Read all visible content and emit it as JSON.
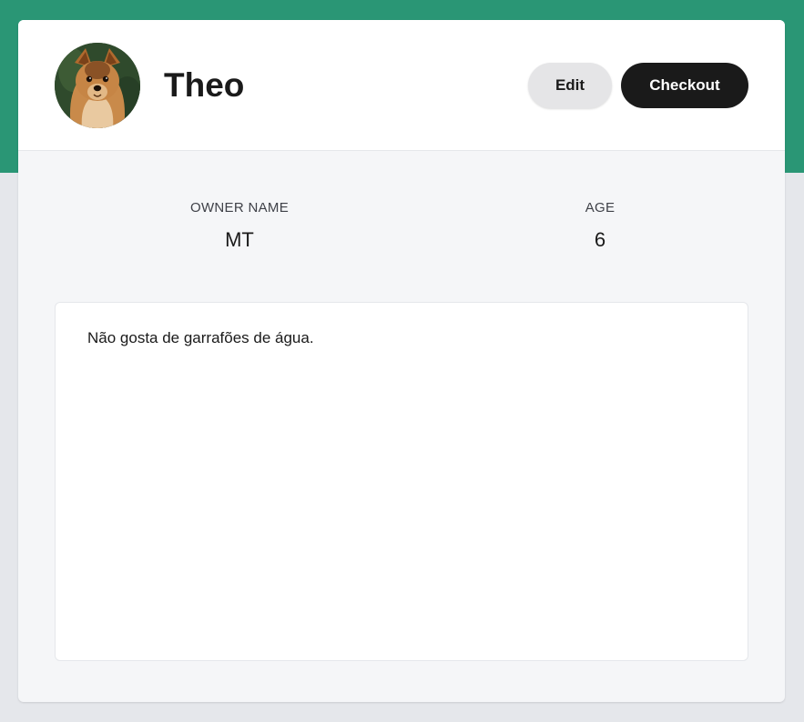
{
  "pet": {
    "name": "Theo",
    "avatar_icon": "dog-photo-avatar"
  },
  "actions": {
    "edit_label": "Edit",
    "checkout_label": "Checkout"
  },
  "stats": {
    "owner_label": "OWNER NAME",
    "owner_value": "MT",
    "age_label": "AGE",
    "age_value": "6"
  },
  "notes": {
    "text": "Não gosta de garrafões de água."
  },
  "colors": {
    "brand": "#2a9675",
    "background": "#e5e7eb",
    "primary_button": "#1a1a1a",
    "secondary_button": "#e5e5e7"
  }
}
